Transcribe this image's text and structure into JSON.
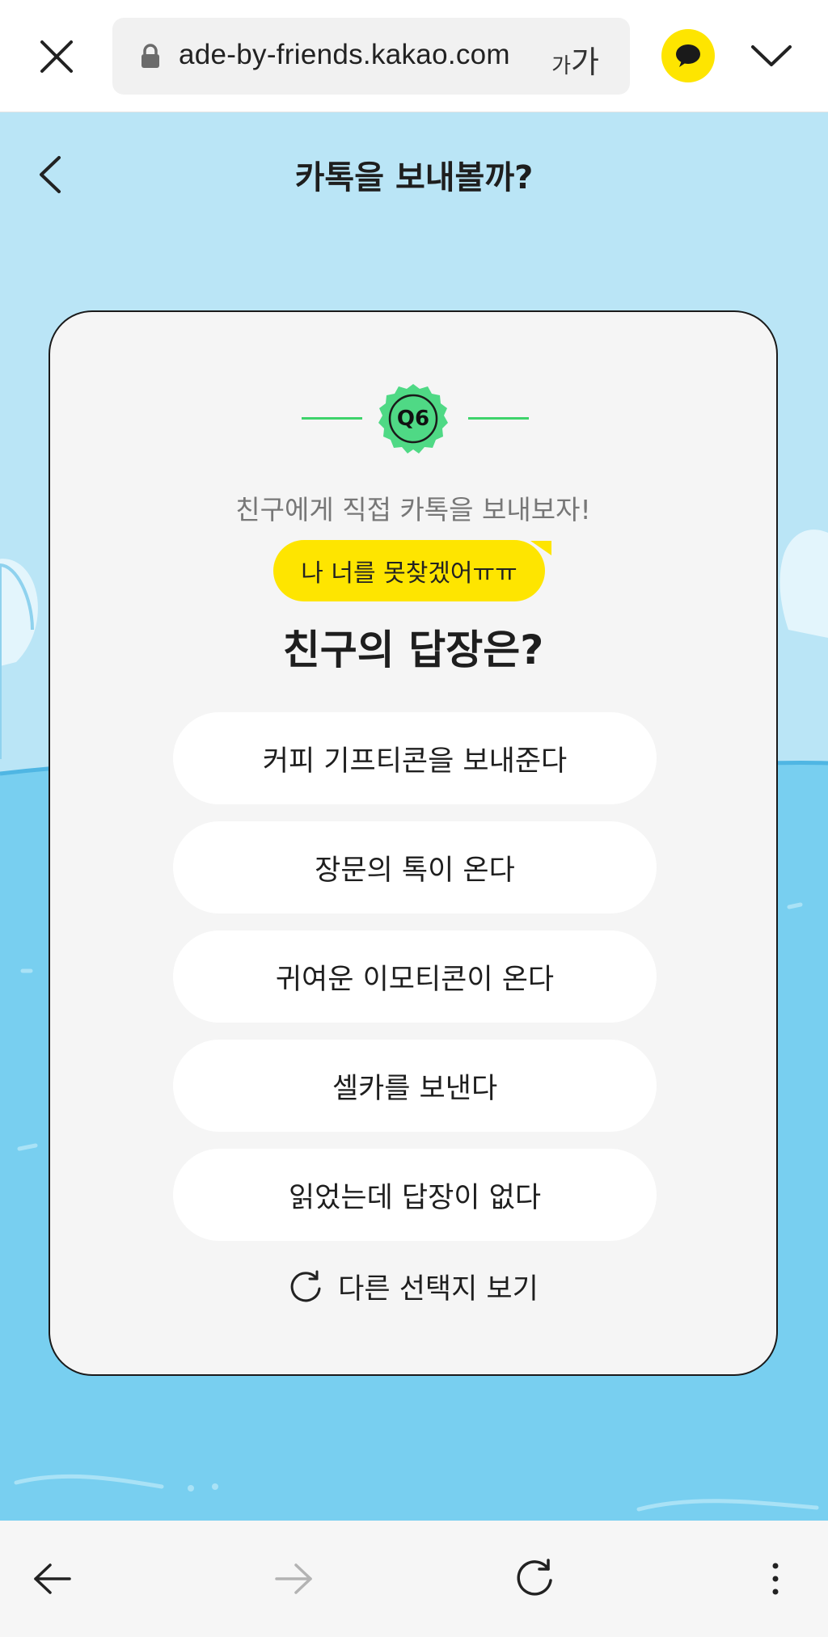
{
  "browser": {
    "url": "ade-by-friends.kakao.com",
    "text_size_small": "가",
    "text_size_large": "가"
  },
  "header": {
    "title": "카톡을 보내볼까?"
  },
  "card": {
    "question_number": "Q6",
    "subtitle": "친구에게 직접 카톡을 보내보자!",
    "message_bubble": "나 너를 못찾겠어ㅠㅠ",
    "question": "친구의 답장은?",
    "options": [
      {
        "label": "커피 기프티콘을 보내준다"
      },
      {
        "label": "장문의 톡이 온다"
      },
      {
        "label": "귀여운 이모티콘이 온다"
      },
      {
        "label": "셀카를 보낸다"
      },
      {
        "label": "읽었는데 답장이 없다"
      }
    ],
    "refresh_label": "다른 선택지 보기"
  },
  "colors": {
    "sky": "#BAE5F6",
    "water": "#78CFF0",
    "badge_green": "#4FD985",
    "bubble_yellow": "#FEE500"
  },
  "icons": {
    "close": "close-icon",
    "lock": "lock-icon",
    "kakao": "kakaotalk-icon",
    "chevron": "chevron-down-icon",
    "back": "back-arrow-icon",
    "refresh": "refresh-icon",
    "nav_back": "arrow-left-icon",
    "nav_forward": "arrow-right-icon",
    "reload": "reload-icon",
    "more": "more-vertical-icon"
  }
}
